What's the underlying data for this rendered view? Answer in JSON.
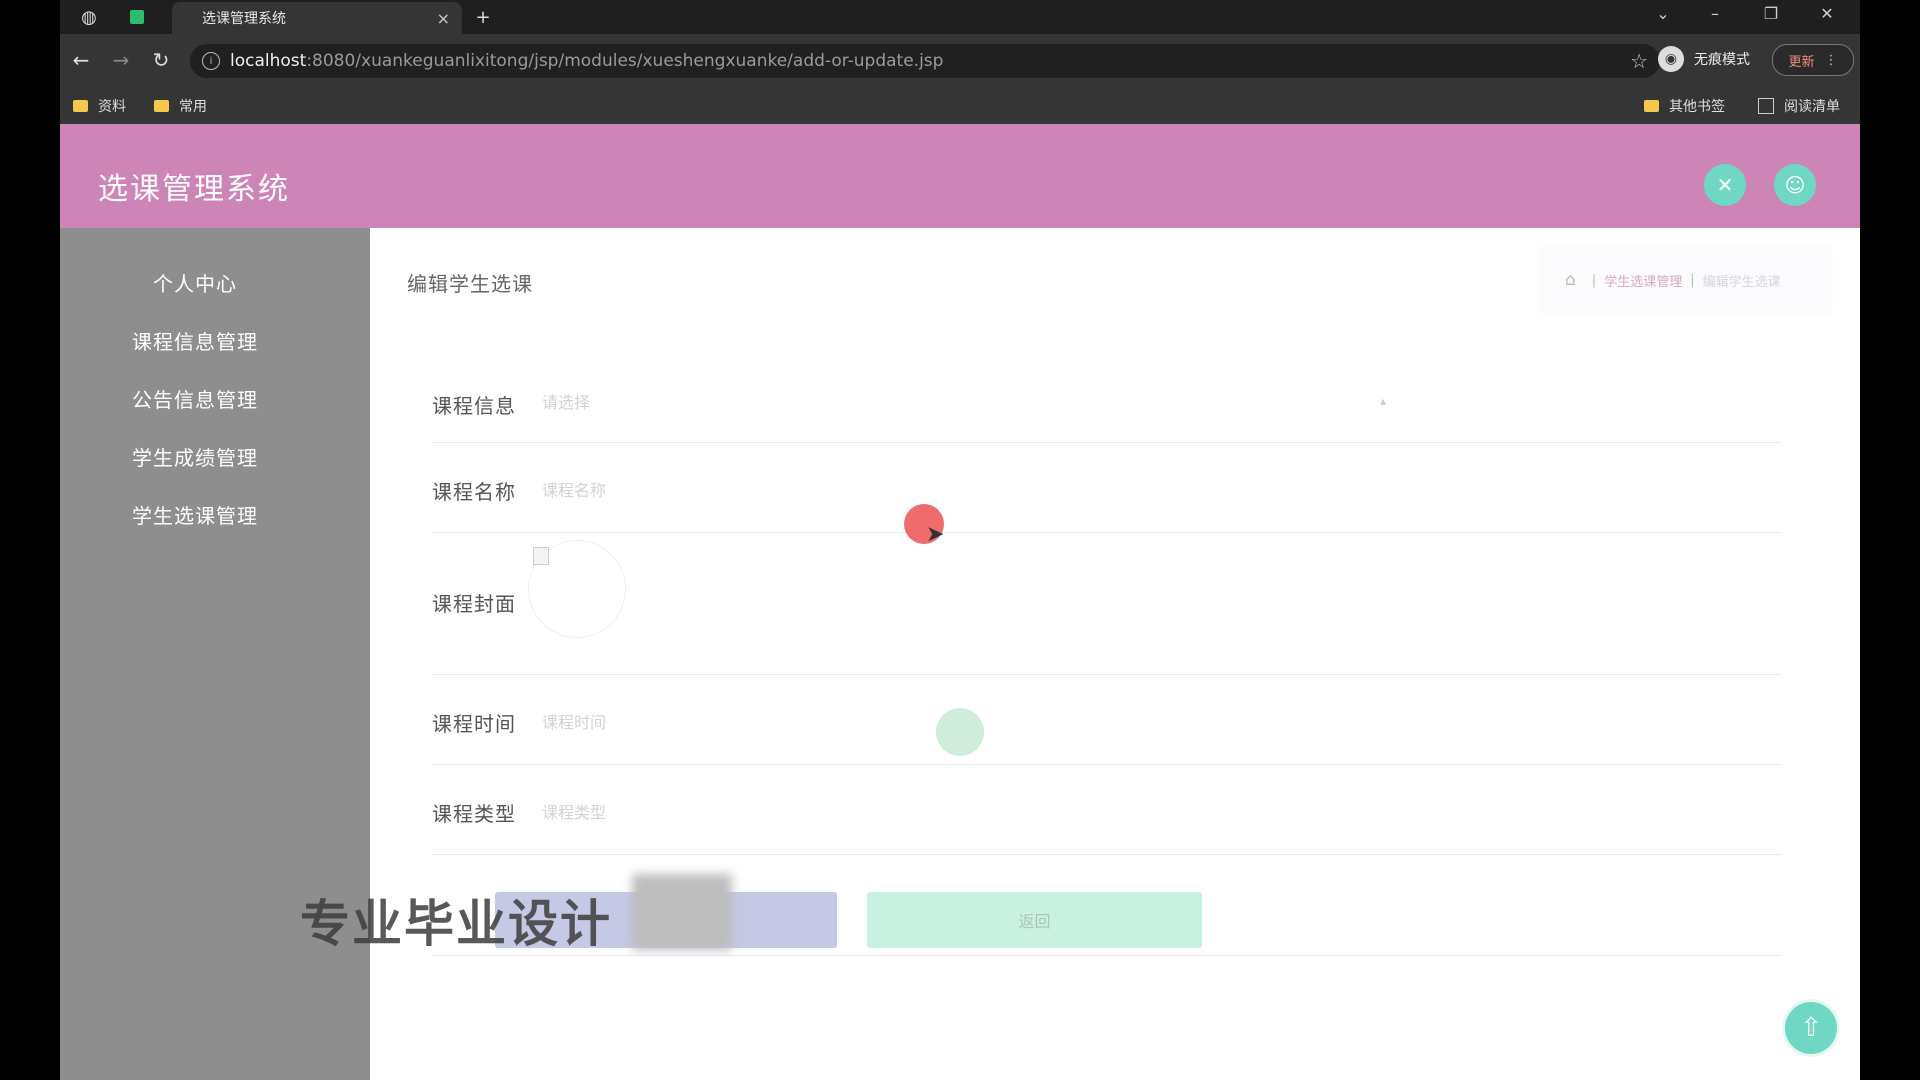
{
  "browser": {
    "tab_title": "选课管理系统",
    "tab_close": "×",
    "new_tab": "+",
    "url_host": "localhost",
    "url_rest": ":8080/xuankeguanlixitong/jsp/modules/xueshengxuanke/add-or-update.jsp",
    "profile_label": "无痕模式",
    "update_label": "更新",
    "bookmarks": [
      "资料",
      "常用"
    ],
    "bookmarks_right": [
      "其他书签",
      "阅读清单"
    ]
  },
  "app": {
    "title": "选课管理系统"
  },
  "sidebar": {
    "items": [
      {
        "label": "个人中心"
      },
      {
        "label": "课程信息管理"
      },
      {
        "label": "公告信息管理"
      },
      {
        "label": "学生成绩管理"
      },
      {
        "label": "学生选课管理"
      }
    ]
  },
  "content": {
    "page_title": "编辑学生选课",
    "breadcrumb": [
      "学生选课管理",
      "编辑学生选课"
    ]
  },
  "form": {
    "course_info_label": "课程信息",
    "course_info_placeholder": "请选择",
    "course_name_label": "课程名称",
    "course_name_placeholder": "课程名称",
    "course_cover_label": "课程封面",
    "course_time_label": "课程时间",
    "course_time_placeholder": "课程时间",
    "course_type_label": "课程类型",
    "course_type_placeholder": "课程类型",
    "back_label": "返回"
  },
  "overlay": {
    "watermark": "专业毕业设计"
  }
}
